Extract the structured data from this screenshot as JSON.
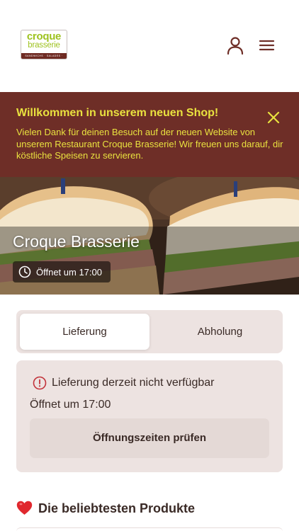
{
  "header": {
    "logo": {
      "line1": "croque",
      "line2": "brasserie",
      "tagline": "SANDWICHS · SALADES · FRENCH"
    },
    "user_icon": "user-icon",
    "menu_icon": "menu-icon"
  },
  "banner": {
    "title": "Willkommen in unserem neuen Shop!",
    "text": "Vielen Dank für deinen Besuch auf der neuen Website von unserem Restaurant Croque Brasserie! Wir freuen uns darauf, dir köstliche Speisen zu servieren.",
    "close_icon": "close-icon",
    "colors": {
      "background": "#6e2e27",
      "text": "#e9e23f"
    }
  },
  "hero": {
    "title": "Croque Brasserie",
    "badge": {
      "icon": "clock-icon",
      "text": "Öffnet um 17:00"
    }
  },
  "tabs": [
    {
      "label": "Lieferung",
      "active": true
    },
    {
      "label": "Abholung",
      "active": false
    }
  ],
  "status_card": {
    "icon": "info-circle-icon",
    "message": "Lieferung derzeit nicht verfügbar",
    "opens_text": "Öffnet um 17:00",
    "button_label": "Öffnungszeiten prüfen"
  },
  "popular": {
    "icon": "heart-icon",
    "title": "Die beliebtesten Produkte"
  }
}
